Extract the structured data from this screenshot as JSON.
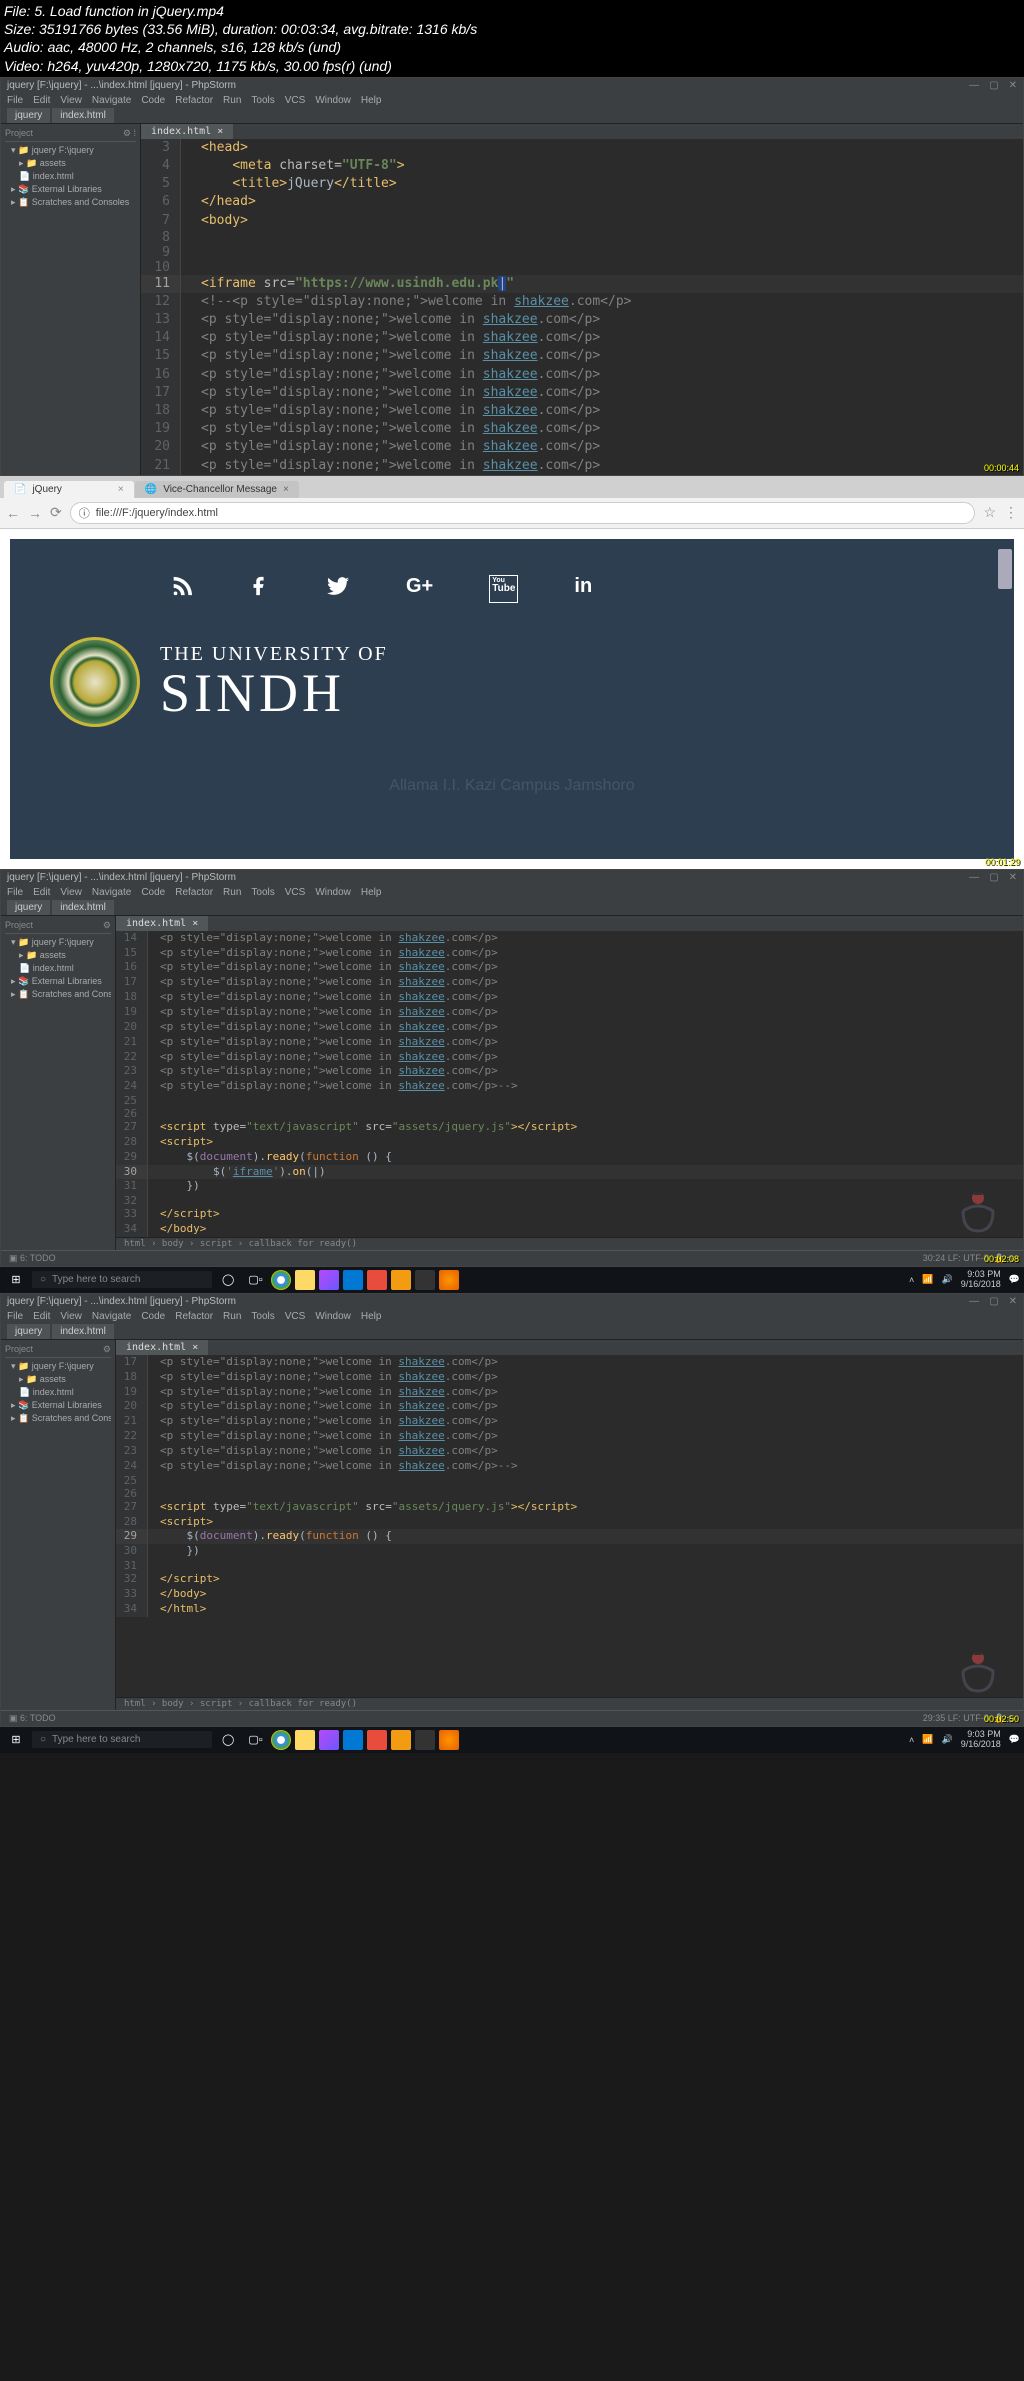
{
  "metadata": {
    "file_line": "File: 5. Load function in jQuery.mp4",
    "size_line": "Size: 35191766 bytes (33.56 MiB), duration: 00:03:34, avg.bitrate: 1316 kb/s",
    "audio_line": "Audio: aac, 48000 Hz, 2 channels, s16, 128 kb/s (und)",
    "video_line": "Video: h264, yuv420p, 1280x720, 1175 kb/s, 30.00 fps(r) (und)"
  },
  "ide": {
    "title": "jquery [F:\\jquery] - ...\\index.html [jquery] - PhpStorm",
    "menus": [
      "File",
      "Edit",
      "View",
      "Navigate",
      "Code",
      "Refactor",
      "Run",
      "Tools",
      "VCS",
      "Window",
      "Help"
    ],
    "path_tab": "jquery",
    "file_tab": "index.html",
    "project_label": "Project",
    "tree": {
      "root": "jquery F:\\jquery",
      "assets": "assets",
      "index": "index.html",
      "ext_lib": "External Libraries",
      "scratches": "Scratches and Consoles"
    },
    "editor_tab": "index.html"
  },
  "code1": {
    "lines": [
      {
        "n": "3",
        "html": "<span class='tag'>&lt;head&gt;</span>"
      },
      {
        "n": "4",
        "html": "    <span class='tag'>&lt;meta </span><span class='attr'>charset=</span><span class='greenbold'>\"UTF-8\"</span><span class='tag'>&gt;</span>"
      },
      {
        "n": "5",
        "html": "    <span class='tag'>&lt;title&gt;</span>jQuery<span class='tag'>&lt;/title&gt;</span>"
      },
      {
        "n": "6",
        "html": "<span class='tag'>&lt;/head&gt;</span>"
      },
      {
        "n": "7",
        "html": "<span class='tag'>&lt;body&gt;</span>"
      },
      {
        "n": "8",
        "html": ""
      },
      {
        "n": "9",
        "html": ""
      },
      {
        "n": "10",
        "html": ""
      },
      {
        "n": "11",
        "caret": true,
        "html": "<span class='tag'>&lt;iframe </span><span class='attr'>src=</span><span class='greenbold'>\"https://www.usindh.edu.pk</span><span style='background:#214283'>|</span><span class='greenbold'>\"</span>"
      },
      {
        "n": "12",
        "html": "<span class='comment'>&lt;!--&lt;p style=\"display:none;\"&gt;welcome in </span><span class='link'>shakzee</span><span class='comment'>.com&lt;/p&gt;</span>"
      },
      {
        "n": "13",
        "html": "<span class='comment'>&lt;p style=\"display:none;\"&gt;welcome in </span><span class='link'>shakzee</span><span class='comment'>.com&lt;/p&gt;</span>"
      },
      {
        "n": "14",
        "html": "<span class='comment'>&lt;p style=\"display:none;\"&gt;welcome in </span><span class='link'>shakzee</span><span class='comment'>.com&lt;/p&gt;</span>"
      },
      {
        "n": "15",
        "html": "<span class='comment'>&lt;p style=\"display:none;\"&gt;welcome in </span><span class='link'>shakzee</span><span class='comment'>.com&lt;/p&gt;</span>"
      },
      {
        "n": "16",
        "html": "<span class='comment'>&lt;p style=\"display:none;\"&gt;welcome in </span><span class='link'>shakzee</span><span class='comment'>.com&lt;/p&gt;</span>"
      },
      {
        "n": "17",
        "html": "<span class='comment'>&lt;p style=\"display:none;\"&gt;welcome in </span><span class='link'>shakzee</span><span class='comment'>.com&lt;/p&gt;</span>"
      },
      {
        "n": "18",
        "html": "<span class='comment'>&lt;p style=\"display:none;\"&gt;welcome in </span><span class='link'>shakzee</span><span class='comment'>.com&lt;/p&gt;</span>"
      },
      {
        "n": "19",
        "html": "<span class='comment'>&lt;p style=\"display:none;\"&gt;welcome in </span><span class='link'>shakzee</span><span class='comment'>.com&lt;/p&gt;</span>"
      },
      {
        "n": "20",
        "html": "<span class='comment'>&lt;p style=\"display:none;\"&gt;welcome in </span><span class='link'>shakzee</span><span class='comment'>.com&lt;/p&gt;</span>"
      },
      {
        "n": "21",
        "html": "<span class='comment'>&lt;p style=\"display:none;\"&gt;welcome in </span><span class='link'>shakzee</span><span class='comment'>.com&lt;/p&gt;</span>"
      }
    ],
    "ts": "00:00:44"
  },
  "browser": {
    "tab1": "jQuery",
    "tab2": "Vice-Chancellor Message",
    "url": "file:///F:/jquery/index.html",
    "uni_line1": "THE UNIVERSITY OF",
    "uni_line2": "SINDH",
    "campus": "Allama I.I. Kazi Campus Jamshoro",
    "ts": "00:01:29"
  },
  "code2": {
    "lines": [
      {
        "n": "14",
        "html": "<span class='comment'>&lt;p style=\"display:none;\"&gt;welcome in </span><span class='link'>shakzee</span><span class='comment'>.com&lt;/p&gt;</span>"
      },
      {
        "n": "15",
        "html": "<span class='comment'>&lt;p style=\"display:none;\"&gt;welcome in </span><span class='link'>shakzee</span><span class='comment'>.com&lt;/p&gt;</span>"
      },
      {
        "n": "16",
        "html": "<span class='comment'>&lt;p style=\"display:none;\"&gt;welcome in </span><span class='link'>shakzee</span><span class='comment'>.com&lt;/p&gt;</span>"
      },
      {
        "n": "17",
        "html": "<span class='comment'>&lt;p style=\"display:none;\"&gt;welcome in </span><span class='link'>shakzee</span><span class='comment'>.com&lt;/p&gt;</span>"
      },
      {
        "n": "18",
        "html": "<span class='comment'>&lt;p style=\"display:none;\"&gt;welcome in </span><span class='link'>shakzee</span><span class='comment'>.com&lt;/p&gt;</span>"
      },
      {
        "n": "19",
        "html": "<span class='comment'>&lt;p style=\"display:none;\"&gt;welcome in </span><span class='link'>shakzee</span><span class='comment'>.com&lt;/p&gt;</span>"
      },
      {
        "n": "20",
        "html": "<span class='comment'>&lt;p style=\"display:none;\"&gt;welcome in </span><span class='link'>shakzee</span><span class='comment'>.com&lt;/p&gt;</span>"
      },
      {
        "n": "21",
        "html": "<span class='comment'>&lt;p style=\"display:none;\"&gt;welcome in </span><span class='link'>shakzee</span><span class='comment'>.com&lt;/p&gt;</span>"
      },
      {
        "n": "22",
        "html": "<span class='comment'>&lt;p style=\"display:none;\"&gt;welcome in </span><span class='link'>shakzee</span><span class='comment'>.com&lt;/p&gt;</span>"
      },
      {
        "n": "23",
        "html": "<span class='comment'>&lt;p style=\"display:none;\"&gt;welcome in </span><span class='link'>shakzee</span><span class='comment'>.com&lt;/p&gt;</span>"
      },
      {
        "n": "24",
        "html": "<span class='comment'>&lt;p style=\"display:none;\"&gt;welcome in </span><span class='link'>shakzee</span><span class='comment'>.com&lt;/p&gt;--&gt;</span>"
      },
      {
        "n": "25",
        "html": ""
      },
      {
        "n": "26",
        "html": ""
      },
      {
        "n": "27",
        "html": "<span class='tag'>&lt;script </span><span class='attr'>type=</span><span class='string'>\"text/javascript\"</span> <span class='attr'>src=</span><span class='string'>\"assets/jquery.js\"</span><span class='tag'>&gt;&lt;/script&gt;</span>"
      },
      {
        "n": "28",
        "html": "<span class='tag'>&lt;script&gt;</span>"
      },
      {
        "n": "29",
        "html": "    $(<span class='jsvar'>document</span>).<span class='ident'>ready</span>(<span class='kw'>function</span> () {"
      },
      {
        "n": "30",
        "caret": true,
        "html": "        $(<span class='string'>'<span class='link' style='text-decoration:underline'>iframe</span>'</span>).<span class='ident'>on</span>(|)"
      },
      {
        "n": "31",
        "html": "    })"
      },
      {
        "n": "32",
        "html": ""
      },
      {
        "n": "33",
        "html": "<span class='tag'>&lt;/script&gt;</span>"
      },
      {
        "n": "34",
        "html": "<span class='tag'>&lt;/body&gt;</span>"
      }
    ],
    "breadcrumb": "html › body › script › callback for ready()",
    "ts": "00:02:08",
    "clock": "9:03 PM",
    "date": "9/16/2018"
  },
  "code3": {
    "lines": [
      {
        "n": "17",
        "html": "<span class='comment'>&lt;p style=\"display:none;\"&gt;welcome in </span><span class='link'>shakzee</span><span class='comment'>.com&lt;/p&gt;</span>"
      },
      {
        "n": "18",
        "html": "<span class='comment'>&lt;p style=\"display:none;\"&gt;welcome in </span><span class='link'>shakzee</span><span class='comment'>.com&lt;/p&gt;</span>"
      },
      {
        "n": "19",
        "html": "<span class='comment'>&lt;p style=\"display:none;\"&gt;welcome in </span><span class='link'>shakzee</span><span class='comment'>.com&lt;/p&gt;</span>"
      },
      {
        "n": "20",
        "html": "<span class='comment'>&lt;p style=\"display:none;\"&gt;welcome in </span><span class='link'>shakzee</span><span class='comment'>.com&lt;/p&gt;</span>"
      },
      {
        "n": "21",
        "html": "<span class='comment'>&lt;p style=\"display:none;\"&gt;welcome in </span><span class='link'>shakzee</span><span class='comment'>.com&lt;/p&gt;</span>"
      },
      {
        "n": "22",
        "html": "<span class='comment'>&lt;p style=\"display:none;\"&gt;welcome in </span><span class='link'>shakzee</span><span class='comment'>.com&lt;/p&gt;</span>"
      },
      {
        "n": "23",
        "html": "<span class='comment'>&lt;p style=\"display:none;\"&gt;welcome in </span><span class='link'>shakzee</span><span class='comment'>.com&lt;/p&gt;</span>"
      },
      {
        "n": "24",
        "html": "<span class='comment'>&lt;p style=\"display:none;\"&gt;welcome in </span><span class='link'>shakzee</span><span class='comment'>.com&lt;/p&gt;--&gt;</span>"
      },
      {
        "n": "25",
        "html": ""
      },
      {
        "n": "26",
        "html": ""
      },
      {
        "n": "27",
        "html": "<span class='tag'>&lt;script </span><span class='attr'>type=</span><span class='string'>\"text/javascript\"</span> <span class='attr'>src=</span><span class='string'>\"assets/jquery.js\"</span><span class='tag'>&gt;&lt;/script&gt;</span>"
      },
      {
        "n": "28",
        "html": "<span class='tag'>&lt;script&gt;</span>"
      },
      {
        "n": "29",
        "caret": true,
        "html": "    $(<span class='jsvar'>document</span>).<span class='ident'>ready</span>(<span class='kw'>function</span> () {"
      },
      {
        "n": "30",
        "html": "    })"
      },
      {
        "n": "31",
        "html": ""
      },
      {
        "n": "32",
        "html": "<span class='tag'>&lt;/script&gt;</span>"
      },
      {
        "n": "33",
        "html": "<span class='tag'>&lt;/body&gt;</span>"
      },
      {
        "n": "34",
        "html": "<span class='tag'>&lt;/html&gt;</span>"
      }
    ],
    "breadcrumb": "html › body › script › callback for ready()",
    "ts": "00:02:50",
    "clock": "9:03 PM",
    "date": "9/16/2018"
  },
  "taskbar": {
    "search_placeholder": "Type here to search"
  }
}
